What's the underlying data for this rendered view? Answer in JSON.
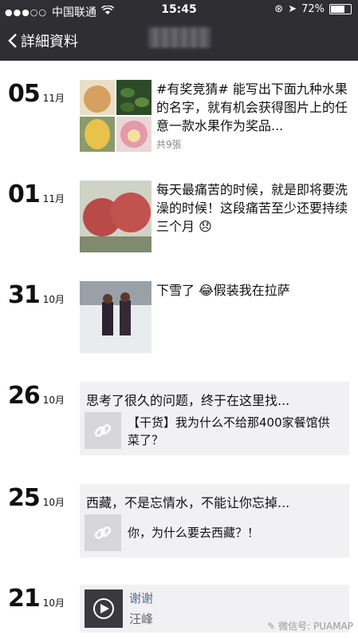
{
  "status": {
    "carrier": "中国联通",
    "time": "15:45",
    "battery": "72%",
    "battery_level": 0.72
  },
  "nav": {
    "back_label": "詳細資料"
  },
  "posts": [
    {
      "day": "05",
      "month": "11月",
      "text": "#有奖竞猜# 能写出下面九种水果的名字，就有机会获得图片上的任意一款水果作为奖品...",
      "count": "共9張"
    },
    {
      "day": "01",
      "month": "11月",
      "text": "每天最痛苦的时候，就是即将要洗澡的时候！这段痛苦至少还要持续三个月 😞"
    },
    {
      "day": "31",
      "month": "10月",
      "text": "下雪了 😂假装我在拉萨"
    },
    {
      "day": "26",
      "month": "10月",
      "text": "思考了很久的问题，终于在这里找...",
      "link": "【干货】我为什么不给那400家餐馆供菜了？"
    },
    {
      "day": "25",
      "month": "10月",
      "text": "西藏，不是忘情水，不能让你忘掉...",
      "link": "你，为什么要去西藏？！"
    },
    {
      "day": "21",
      "month": "10月",
      "music_title": "谢谢",
      "music_artist": "汪峰"
    }
  ],
  "watermark": "微信号: PUAMAP"
}
